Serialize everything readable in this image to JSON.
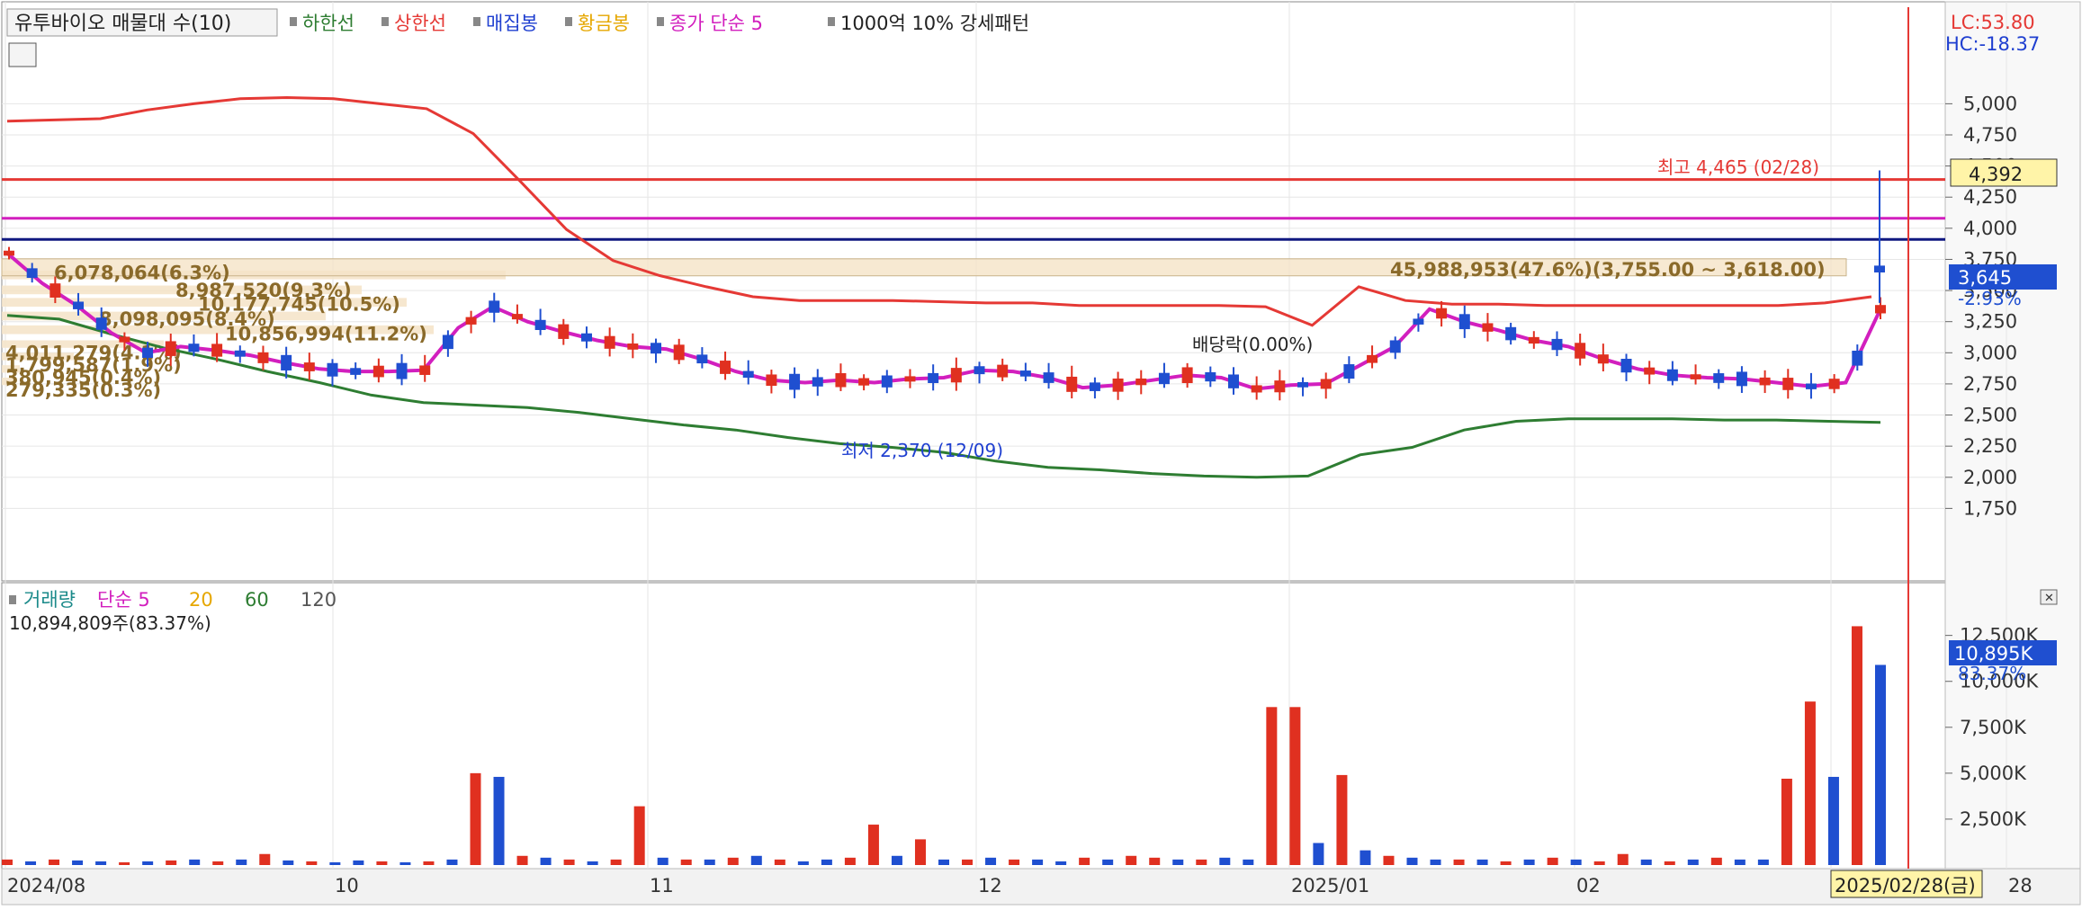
{
  "header": {
    "title": "유투바이오 매물대 수(10)",
    "legend": [
      {
        "label": "하한선",
        "color": "#2e7d32"
      },
      {
        "label": "상한선",
        "color": "#e53935"
      },
      {
        "label": "매집봉",
        "color": "#1f3fd0"
      },
      {
        "label": "황금봉",
        "color": "#e6a700"
      },
      {
        "label": "종가 단순 5",
        "color": "#d21fbe"
      },
      {
        "label": "1000억 10% 강세패턴",
        "color": "#222222"
      }
    ],
    "lc": "LC:53.80",
    "hc": "HC:-18.37"
  },
  "price_panel": {
    "current_price": "4,392",
    "last_close": "3,645",
    "change_pct": "-2.93%",
    "high_annotation": "최고 4,465 (02/28)",
    "low_annotation": "최저 2,370 (12/09)",
    "dividend_annotation": "배당락(0.00%)",
    "volume_profile": [
      "6,078,064(6.3%)",
      "8,987,520(9.3%)",
      "10,177,745(10.5%)",
      "8,098,095(8.4%)",
      "10,856,994(11.2%)",
      "4,011,279(4.1%)",
      "1,799,587(1.9%)",
      "380,945(0.4%)",
      "279,335(0.3%)",
      "45,988,953(47.6%)(3,755.00 ~ 3,618.00)"
    ]
  },
  "volume_panel": {
    "legend": [
      {
        "label": "거래량",
        "color": "#1b8a8a"
      },
      {
        "label": "단순 5",
        "color": "#d21fbe"
      },
      {
        "label": "20",
        "color": "#e6a700"
      },
      {
        "label": "60",
        "color": "#2e7d32"
      },
      {
        "label": "120",
        "color": "#555555"
      }
    ],
    "last_volume_text": "10,894,809주(83.37%)",
    "current_volume": "10,895K",
    "current_ratio": "83.37%"
  },
  "x_axis": {
    "labels": [
      "2024/08",
      "10",
      "11",
      "12",
      "2025/01",
      "02",
      "2025/02/28(금)",
      "28"
    ]
  },
  "chart_data": [
    {
      "type": "candlestick",
      "y_ticks": [
        "5,000",
        "4,750",
        "4,500",
        "4,250",
        "4,000",
        "3,750",
        "3,500",
        "3,250",
        "3,000",
        "2,750",
        "2,500",
        "2,250",
        "2,000",
        "1,750"
      ],
      "ylim": [
        1500,
        5400
      ],
      "high": 4465,
      "low": 2370,
      "last": 3645,
      "horizontal_lines": [
        {
          "value": 4392,
          "color": "#e53935"
        },
        {
          "value": 4080,
          "color": "#d21fbe"
        },
        {
          "value": 3910,
          "color": "#101880"
        }
      ],
      "series": [
        {
          "name": "상한선",
          "color": "#e53935",
          "values": [
            4860,
            4870,
            4880,
            4950,
            5000,
            5040,
            5050,
            5040,
            5000,
            4960,
            4760,
            4380,
            3990,
            3740,
            3620,
            3530,
            3450,
            3420,
            3420,
            3420,
            3410,
            3400,
            3400,
            3380,
            3380,
            3380,
            3380,
            3370,
            3220,
            3530,
            3420,
            3390,
            3390,
            3380,
            3380,
            3380,
            3380,
            3380,
            3380,
            3400,
            3450
          ]
        },
        {
          "name": "하한선",
          "color": "#2e7d32",
          "values": [
            3300,
            3270,
            3150,
            3040,
            2950,
            2850,
            2760,
            2660,
            2600,
            2580,
            2560,
            2520,
            2470,
            2420,
            2380,
            2320,
            2270,
            2240,
            2200,
            2130,
            2080,
            2060,
            2030,
            2010,
            2000,
            2010,
            2180,
            2240,
            2380,
            2450,
            2470,
            2470,
            2470,
            2460,
            2460,
            2450,
            2440
          ]
        },
        {
          "name": "종가 단순 5",
          "color": "#d21fbe",
          "values": [
            3800,
            3560,
            3380,
            3160,
            3000,
            3050,
            3020,
            2980,
            2920,
            2870,
            2850,
            2850,
            2860,
            3200,
            3370,
            3250,
            3170,
            3100,
            3050,
            3030,
            2950,
            2850,
            2780,
            2760,
            2780,
            2760,
            2790,
            2800,
            2860,
            2850,
            2800,
            2720,
            2740,
            2780,
            2820,
            2800,
            2710,
            2740,
            2750,
            2900,
            3050,
            3350,
            3250,
            3180,
            3100,
            3050,
            2950,
            2870,
            2820,
            2800,
            2790,
            2760,
            2730,
            2760,
            3350
          ]
        }
      ]
    },
    {
      "type": "bar",
      "series_name": "거래량",
      "y_ticks": [
        "12,500K",
        "10,000K",
        "7,500K",
        "5,000K",
        "2,500K"
      ],
      "ylim": [
        0,
        14000
      ],
      "values": [
        300,
        200,
        300,
        250,
        200,
        150,
        200,
        250,
        300,
        200,
        300,
        600,
        250,
        200,
        150,
        250,
        200,
        150,
        200,
        300,
        5000,
        4800,
        500,
        400,
        300,
        200,
        300,
        3200,
        400,
        300,
        300,
        400,
        500,
        300,
        200,
        300,
        400,
        2200,
        500,
        1400,
        300,
        300,
        400,
        300,
        300,
        200,
        400,
        300,
        500,
        400,
        300,
        300,
        400,
        300,
        8600,
        8600,
        1200,
        4900,
        800,
        500,
        400,
        300,
        300,
        300,
        200,
        300,
        400,
        300,
        200,
        600,
        300,
        200,
        300,
        400,
        300,
        300,
        4700,
        8900,
        4800,
        13000,
        10895
      ],
      "up_flags": [
        1,
        0,
        1,
        0,
        0,
        1,
        0,
        1,
        0,
        1,
        0,
        1,
        0,
        1,
        0,
        0,
        1,
        0,
        1,
        0,
        1,
        0,
        1,
        0,
        1,
        0,
        1,
        1,
        0,
        1,
        0,
        1,
        0,
        1,
        0,
        0,
        1,
        1,
        0,
        1,
        0,
        1,
        0,
        1,
        0,
        0,
        1,
        0,
        1,
        1,
        0,
        1,
        0,
        0,
        1,
        1,
        0,
        1,
        0,
        1,
        0,
        0,
        1,
        0,
        1,
        0,
        1,
        0,
        1,
        1,
        0,
        1,
        0,
        1,
        0,
        0,
        1,
        1,
        0,
        1,
        0
      ]
    }
  ]
}
